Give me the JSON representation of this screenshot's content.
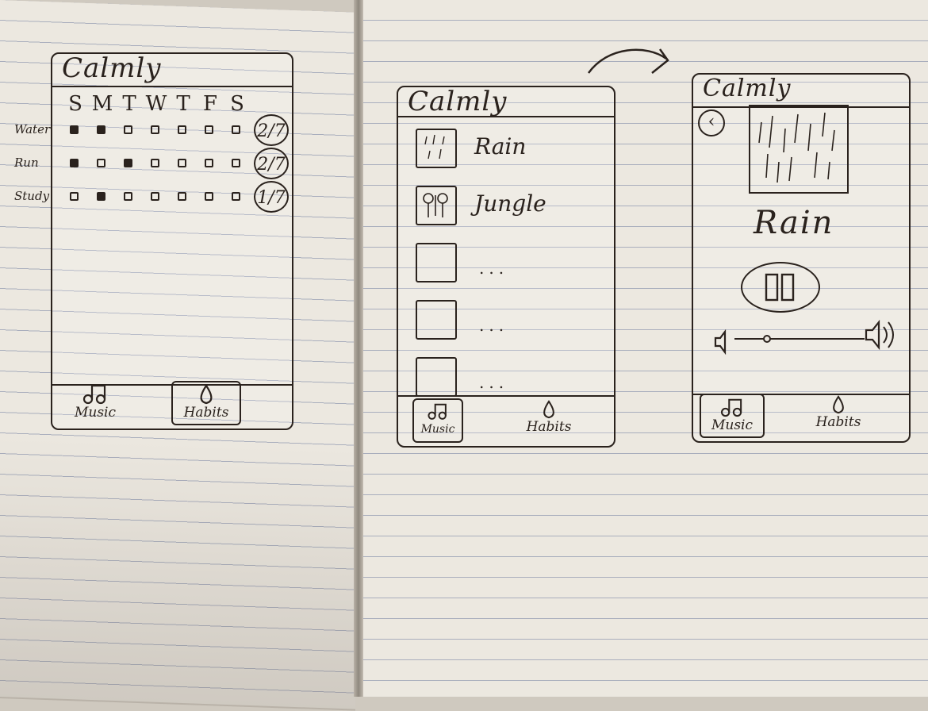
{
  "app": {
    "title": "Calmly"
  },
  "tabs": {
    "music_label": "Music",
    "habits_label": "Habits"
  },
  "habits_screen": {
    "days": [
      "S",
      "M",
      "T",
      "W",
      "T",
      "F",
      "S"
    ],
    "habits": [
      {
        "label": "Water",
        "done": [
          true,
          true,
          false,
          false,
          false,
          false,
          false
        ],
        "count": "2/7"
      },
      {
        "label": "Run",
        "done": [
          true,
          false,
          true,
          false,
          false,
          false,
          false
        ],
        "count": "2/7"
      },
      {
        "label": "Study",
        "done": [
          false,
          true,
          false,
          false,
          false,
          false,
          false
        ],
        "count": "1/7"
      }
    ]
  },
  "music_screen": {
    "tracks": [
      {
        "label": "Rain",
        "icon": "rain-icon"
      },
      {
        "label": "Jungle",
        "icon": "trees-icon"
      },
      {
        "label": "...",
        "icon": "blank-thumbnail"
      },
      {
        "label": "...",
        "icon": "blank-thumbnail"
      },
      {
        "label": "...",
        "icon": "blank-thumbnail"
      }
    ]
  },
  "player_screen": {
    "track_title": "Rain",
    "state": "playing",
    "volume": 0.25
  },
  "colors": {
    "ink": "#2a221d",
    "paper": "#ece8e0",
    "rule": "#a9aebd"
  }
}
